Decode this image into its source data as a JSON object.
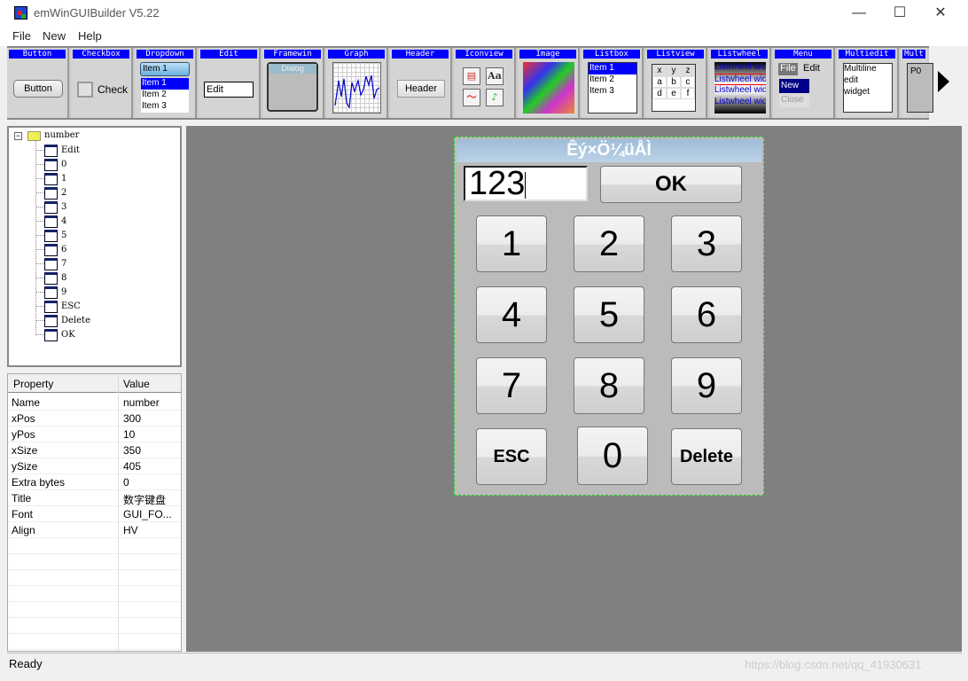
{
  "window": {
    "title": "emWinGUIBuilder V5.22"
  },
  "menu": [
    "File",
    "New",
    "Help"
  ],
  "toolbar": {
    "widgets": [
      "Button",
      "Checkbox",
      "Dropdown",
      "Edit",
      "Framewin",
      "Graph",
      "Header",
      "Iconview",
      "Image",
      "Listbox",
      "Listview",
      "Listwheel",
      "Menu",
      "Multiedit",
      "Mult"
    ],
    "button_label": "Button",
    "checkbox_label": "Check",
    "dropdown_selected": "Item 1",
    "dropdown_items": [
      "Item 1",
      "Item 2",
      "Item 3"
    ],
    "edit_value": "Edit",
    "framewin_title": "Dialog",
    "header_label": "Header",
    "iconview_text": "Aa",
    "listbox_items": [
      "Item 1",
      "Item 2",
      "Item 3"
    ],
    "listview_headers": [
      "x",
      "y",
      "z"
    ],
    "listview_rows": [
      [
        "a",
        "b",
        "c"
      ],
      [
        "d",
        "e",
        "f"
      ]
    ],
    "listwheel_item": "Listwheel wid",
    "menu_items": [
      "File",
      "Edit"
    ],
    "menu_sub": [
      "New",
      "Close"
    ],
    "multiedit_lines": [
      "Multiline",
      "edit",
      "widget"
    ],
    "multipage_tab": "P0"
  },
  "tree": {
    "root": "number",
    "children": [
      "Edit",
      "0",
      "1",
      "2",
      "3",
      "4",
      "5",
      "6",
      "7",
      "8",
      "9",
      "ESC",
      "Delete",
      "OK"
    ]
  },
  "properties": {
    "headers": [
      "Property",
      "Value"
    ],
    "rows": [
      [
        "Name",
        "number"
      ],
      [
        "xPos",
        "300"
      ],
      [
        "yPos",
        "10"
      ],
      [
        "xSize",
        "350"
      ],
      [
        "ySize",
        "405"
      ],
      [
        "Extra bytes",
        "0"
      ],
      [
        "Title",
        "数字键盘"
      ],
      [
        "Font",
        "GUI_FO..."
      ],
      [
        "Align",
        "HV"
      ]
    ]
  },
  "dialog": {
    "title": "Êý×Ö¼üÅÌ",
    "edit_value": "123",
    "ok": "OK",
    "keys": [
      "1",
      "2",
      "3",
      "4",
      "5",
      "6",
      "7",
      "8",
      "9",
      "ESC",
      "0",
      "Delete"
    ]
  },
  "status": "Ready",
  "watermark": "https://blog.csdn.net/qq_41930631",
  "colors": {
    "header_blue": "#0000ff",
    "canvas": "#808080",
    "dialog_bg": "#bbbbbb"
  }
}
